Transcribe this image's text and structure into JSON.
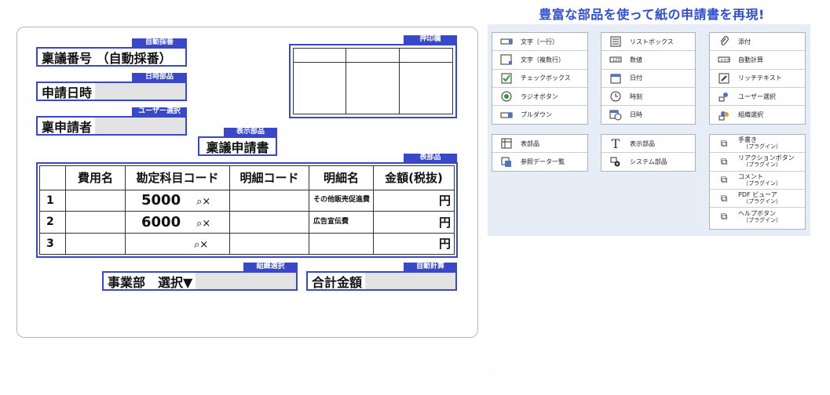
{
  "headline": "豊富な部品を使って紙の申請書を再現!",
  "form": {
    "tags": {
      "auto_number": "自動採番",
      "datetime": "日時部品",
      "user_select": "ユーザー選択",
      "display": "表示部品",
      "stamp": "押印欄",
      "table": "表部品",
      "org_select": "組織選択",
      "auto_calc": "自動計算"
    },
    "fields": {
      "number": "稟議番号 （自動採番）",
      "date": "申請日時",
      "applicant": "稟申請者",
      "title": "稟議申請書",
      "dept": "事業部　選択▼",
      "total": "合計金額"
    },
    "table": {
      "headers": [
        "",
        "費用名",
        "勘定科目コード",
        "明細コード",
        "明細名",
        "金額(税抜)"
      ],
      "rows": [
        {
          "no": "1",
          "code": "5000",
          "icons": "⌕×",
          "detail": "その他販売促進費",
          "yen": "円"
        },
        {
          "no": "2",
          "code": "6000",
          "icons": "⌕×",
          "detail": "広告宣伝費",
          "yen": "円"
        },
        {
          "no": "3",
          "code": "",
          "icons": "⌕×",
          "detail": "",
          "yen": "円"
        }
      ]
    }
  },
  "parts": {
    "col1": [
      {
        "icon": "text-line-icon",
        "label": "文字（一行）"
      },
      {
        "icon": "text-multiline-icon",
        "label": "文字（複数行）"
      },
      {
        "icon": "checkbox-icon",
        "label": "チェックボックス"
      },
      {
        "icon": "radio-icon",
        "label": "ラジオボタン"
      },
      {
        "icon": "dropdown-icon",
        "label": "プルダウン"
      }
    ],
    "col2": [
      {
        "icon": "listbox-icon",
        "label": "リストボックス"
      },
      {
        "icon": "number-icon",
        "label": "数値"
      },
      {
        "icon": "calendar-icon",
        "label": "日付"
      },
      {
        "icon": "clock-icon",
        "label": "時刻"
      },
      {
        "icon": "datetime-icon",
        "label": "日時"
      }
    ],
    "col3": [
      {
        "icon": "paperclip-icon",
        "label": "添付"
      },
      {
        "icon": "auto-calc-icon",
        "label": "自動計算"
      },
      {
        "icon": "richtext-icon",
        "label": "リッチテキスト"
      },
      {
        "icon": "user-select-icon",
        "label": "ユーザー選択"
      },
      {
        "icon": "org-select-icon",
        "label": "組織選択"
      }
    ],
    "col4": [
      {
        "icon": "table-icon",
        "label": "表部品"
      },
      {
        "icon": "data-list-icon",
        "label": "参照データ一覧"
      }
    ],
    "col5": [
      {
        "icon": "display-text-icon",
        "label": "表示部品"
      },
      {
        "icon": "system-icon",
        "label": "システム部品"
      }
    ],
    "col6": [
      {
        "icon": "puzzle-icon",
        "label": "手書き",
        "sub": "（プラグイン）"
      },
      {
        "icon": "puzzle-icon",
        "label": "リアクションボタン",
        "sub": "（プラグイン）"
      },
      {
        "icon": "puzzle-icon",
        "label": "コメント",
        "sub": "（プラグイン）"
      },
      {
        "icon": "puzzle-icon",
        "label": "PDF ビューア",
        "sub": "（プラグイン）"
      },
      {
        "icon": "puzzle-icon",
        "label": "ヘルプボタン",
        "sub": "（プラグイン）"
      }
    ]
  },
  "footnote": "·"
}
